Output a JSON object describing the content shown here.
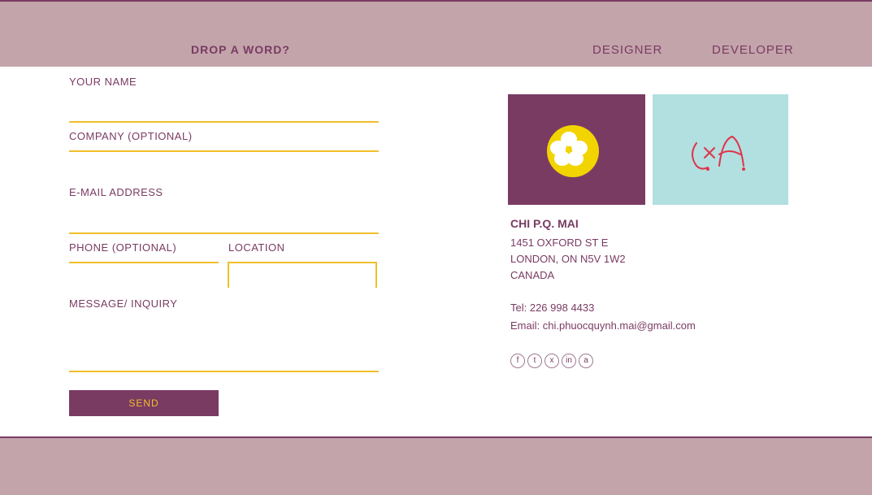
{
  "header": {
    "title": "DROP A WORD?",
    "nav": [
      "DESIGNER",
      "DEVELOPER"
    ]
  },
  "form": {
    "your_name_label": "YOUR NAME",
    "company_label": "COMPANY (OPTIONAL)",
    "email_label": "E-MAIL ADDRESS",
    "phone_label": "PHONE (OPTIONAL)",
    "location_label": "LOCATION",
    "message_label": "MESSAGE/ INQUIRY",
    "send_label": "SEND"
  },
  "contact": {
    "name": "CHI P.Q. MAI",
    "address_line1": "1451 OXFORD ST E",
    "address_line2": "LONDON, ON N5V 1W2",
    "address_line3": "CANADA",
    "tel": "Tel: 226 998 4433",
    "email": "Email: chi.phuocquynh.mai@gmail.com"
  },
  "social": [
    {
      "icon": "facebook-icon",
      "glyph": "f"
    },
    {
      "icon": "twitter-icon",
      "glyph": "t"
    },
    {
      "icon": "dribbble-icon",
      "glyph": "x"
    },
    {
      "icon": "linkedin-icon",
      "glyph": "in"
    },
    {
      "icon": "behance-icon",
      "glyph": "a"
    }
  ],
  "colors": {
    "band": "#c3a4aa",
    "accent": "#7a3b63",
    "underline": "#f1bf2b",
    "flower_yellow": "#f2d400",
    "teal": "#b2dfe0",
    "logo_red": "#e0334a"
  }
}
